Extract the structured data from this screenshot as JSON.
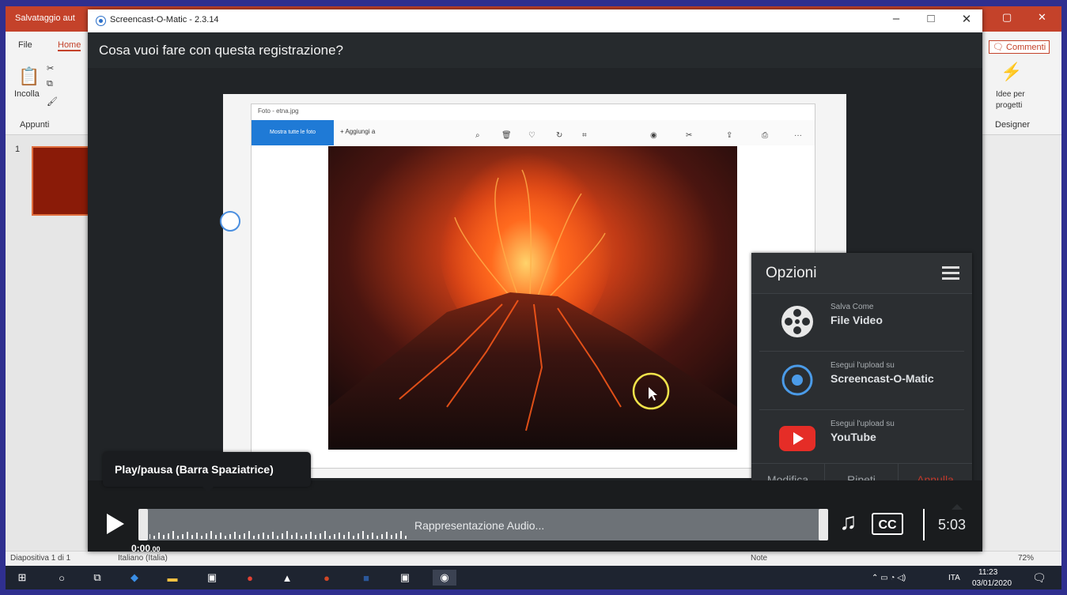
{
  "ppt": {
    "autosave_title": "Salvataggio aut",
    "menu_file": "File",
    "menu_home": "Home",
    "paste_label": "Incolla",
    "clipboard_group": "Appunti",
    "comments_button": "Commenti",
    "designer_label_1": "Idee per",
    "designer_label_2": "progetti",
    "designer_group": "Designer",
    "slide_number": "1",
    "status_slide": "Diapositiva 1 di 1",
    "status_language": "Italiano (Italia)",
    "status_notes": "Note",
    "status_zoom": "72%"
  },
  "som": {
    "app_title": "Screencast-O-Matic - 2.3.14",
    "question": "Cosa vuoi fare con questa registrazione?",
    "photos": {
      "window_title": "Foto - etna.jpg",
      "view_all_button": "Mostra tutte le foto",
      "add_button": "Aggiungi a"
    },
    "options": {
      "title": "Opzioni",
      "items": [
        {
          "small": "Salva Come",
          "big": "File Video",
          "icon": "film-reel-icon"
        },
        {
          "small": "Esegui l'upload su",
          "big": "Screencast-O-Matic",
          "icon": "screencast-logo-icon"
        },
        {
          "small": "Esegui l'upload su",
          "big": "YouTube",
          "icon": "youtube-icon"
        }
      ],
      "edit_button": "Modifica",
      "repeat_button": "Ripeti",
      "cancel_button": "Annulla",
      "cancel_color": "#c0392b"
    },
    "tooltip": "Play/pausa (Barra Spaziatrice)",
    "timeline_label": "Rappresentazione Audio...",
    "current_time": "0:00",
    "current_time_fraction": ".00",
    "duration": "5:03",
    "cc_label": "CC"
  },
  "taskbar": {
    "language": "ITA",
    "time": "11:23",
    "date": "03/01/2020"
  }
}
